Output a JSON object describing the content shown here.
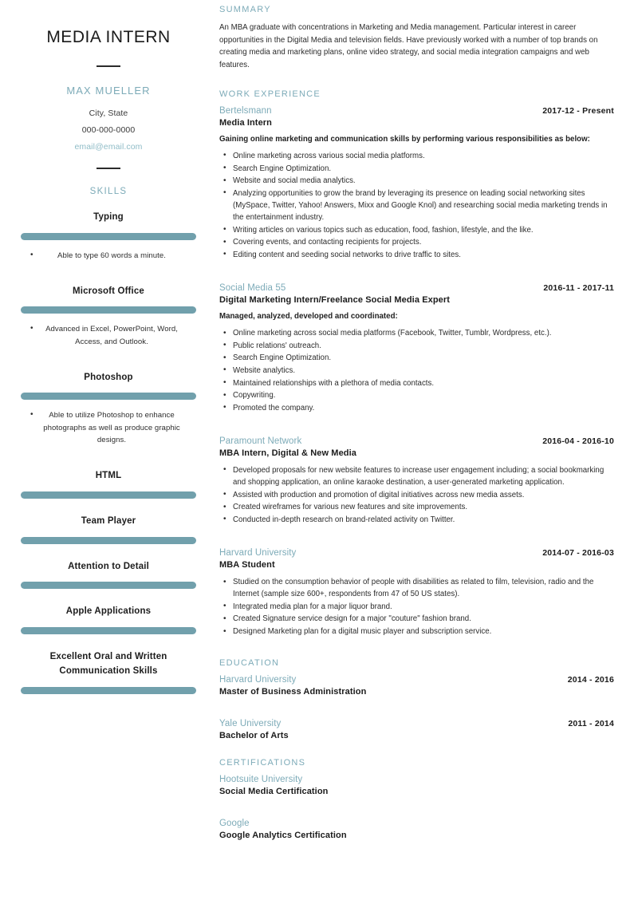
{
  "sidebar": {
    "job_title": "MEDIA INTERN",
    "full_name": "MAX MUELLER",
    "location": "City, State",
    "phone": "000-000-0000",
    "email": "email@email.com",
    "skills_heading": "SKILLS",
    "skills": [
      {
        "name": "Typing",
        "details": [
          "Able to type 60 words a minute."
        ]
      },
      {
        "name": "Microsoft Office",
        "details": [
          "Advanced in Excel, PowerPoint, Word, Access, and Outlook."
        ]
      },
      {
        "name": "Photoshop",
        "details": [
          "Able to utilize Photoshop to enhance photographs as well as produce graphic designs."
        ]
      },
      {
        "name": "HTML",
        "details": []
      },
      {
        "name": "Team Player",
        "details": []
      },
      {
        "name": "Attention to Detail",
        "details": []
      },
      {
        "name": "Apple Applications",
        "details": []
      },
      {
        "name": "Excellent Oral and Written Communication Skills",
        "details": []
      }
    ]
  },
  "main": {
    "summary": {
      "heading": "SUMMARY",
      "text": "An MBA graduate with concentrations in Marketing and Media management. Particular interest in career opportunities in the Digital Media and television fields. Have previously worked with a number of top brands on creating media and marketing plans, online video strategy, and social media integration campaigns and web features."
    },
    "work_experience": {
      "heading": "WORK EXPERIENCE",
      "entries": [
        {
          "org": "Bertelsmann",
          "dates": "2017-12 - Present",
          "role": "Media Intern",
          "intro": "Gaining online marketing and communication skills by performing various responsibilities as below:",
          "bullets": [
            "Online marketing across various social media platforms.",
            "Search Engine Optimization.",
            "Website and social media analytics.",
            "Analyzing opportunities to grow the brand by leveraging its presence on leading social networking sites (MySpace, Twitter, Yahoo! Answers, Mixx and Google Knol) and researching social media marketing trends in the entertainment industry.",
            "Writing articles on various topics such as education, food, fashion, lifestyle, and the like.",
            "Covering events, and contacting recipients for projects.",
            "Editing content and seeding social networks to drive traffic to sites."
          ]
        },
        {
          "org": "Social Media 55",
          "dates": "2016-11 - 2017-11",
          "role": "Digital Marketing Intern/Freelance Social Media Expert",
          "intro": "Managed, analyzed, developed and coordinated:",
          "bullets": [
            "Online marketing across social media platforms (Facebook, Twitter, Tumblr, Wordpress, etc.).",
            "Public relations' outreach.",
            "Search Engine Optimization.",
            "Website analytics.",
            "Maintained relationships with a plethora of media contacts.",
            "Copywriting.",
            "Promoted the company."
          ]
        },
        {
          "org": "Paramount Network",
          "dates": "2016-04 - 2016-10",
          "role": "MBA Intern, Digital & New Media",
          "intro": "",
          "bullets": [
            "Developed proposals for new website features to increase user engagement including; a social bookmarking and shopping application, an online karaoke destination, a user-generated marketing application.",
            "Assisted with production and promotion of digital initiatives across new media assets.",
            "Created wireframes for various new features and site improvements.",
            "Conducted in-depth research on brand-related activity on Twitter."
          ]
        },
        {
          "org": "Harvard University",
          "dates": "2014-07 - 2016-03",
          "role": "MBA Student",
          "intro": "",
          "bullets": [
            "Studied on the consumption behavior of people with disabilities as related to film, television, radio and the Internet (sample size 600+, respondents from 47 of 50 US states).",
            "Integrated media plan for a major liquor brand.",
            "Created Signature service design for a major \"couture\" fashion brand.",
            "Designed Marketing plan for a digital music player and subscription service."
          ]
        }
      ]
    },
    "education": {
      "heading": "EDUCATION",
      "entries": [
        {
          "org": "Harvard University",
          "dates": "2014 - 2016",
          "degree": "Master of Business Administration"
        },
        {
          "org": "Yale University",
          "dates": "2011 - 2014",
          "degree": "Bachelor of Arts"
        }
      ]
    },
    "certifications": {
      "heading": "CERTIFICATIONS",
      "entries": [
        {
          "org": "Hootsuite University",
          "dates": "",
          "degree": "Social Media Certification"
        },
        {
          "org": "Google",
          "dates": "",
          "degree": "Google Analytics Certification"
        }
      ]
    }
  },
  "colors": {
    "accent": "#7dabb8",
    "bar": "#71a0ac",
    "text": "#2b2b2b"
  }
}
